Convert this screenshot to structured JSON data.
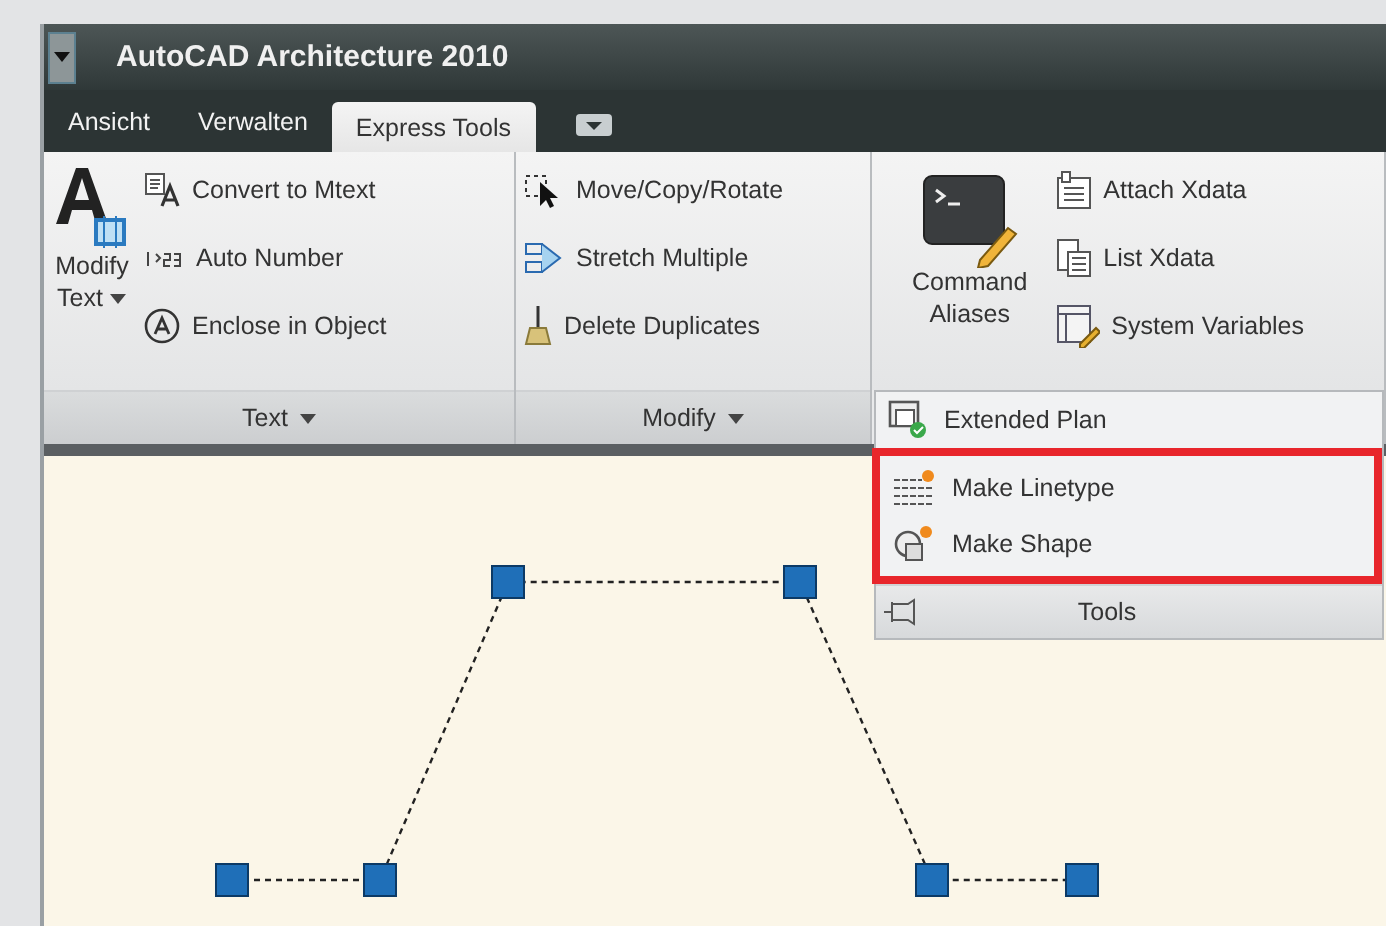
{
  "window": {
    "title": "AutoCAD Architecture 2010"
  },
  "tabs": [
    {
      "label": "Ansicht",
      "selected": false
    },
    {
      "label": "Verwalten",
      "selected": false
    },
    {
      "label": "Express Tools",
      "selected": true
    }
  ],
  "panels": [
    {
      "label": "Text",
      "big_button": {
        "lines": [
          "Modify",
          "Text"
        ]
      },
      "items": [
        "Convert to Mtext",
        "Auto Number",
        "Enclose in Object"
      ]
    },
    {
      "label": "Modify",
      "items": [
        "Move/Copy/Rotate",
        "Stretch Multiple",
        "Delete Duplicates"
      ]
    },
    {
      "label": "Tools",
      "big_button": {
        "lines": [
          "Command",
          "Aliases"
        ]
      },
      "items": [
        "Attach Xdata",
        "List Xdata",
        "System Variables"
      ],
      "expanded": {
        "items": [
          {
            "label": "Extended Plan",
            "highlighted": false
          },
          {
            "label": "Make Linetype",
            "highlighted": true
          },
          {
            "label": "Make Shape",
            "highlighted": true
          }
        ]
      }
    }
  ]
}
